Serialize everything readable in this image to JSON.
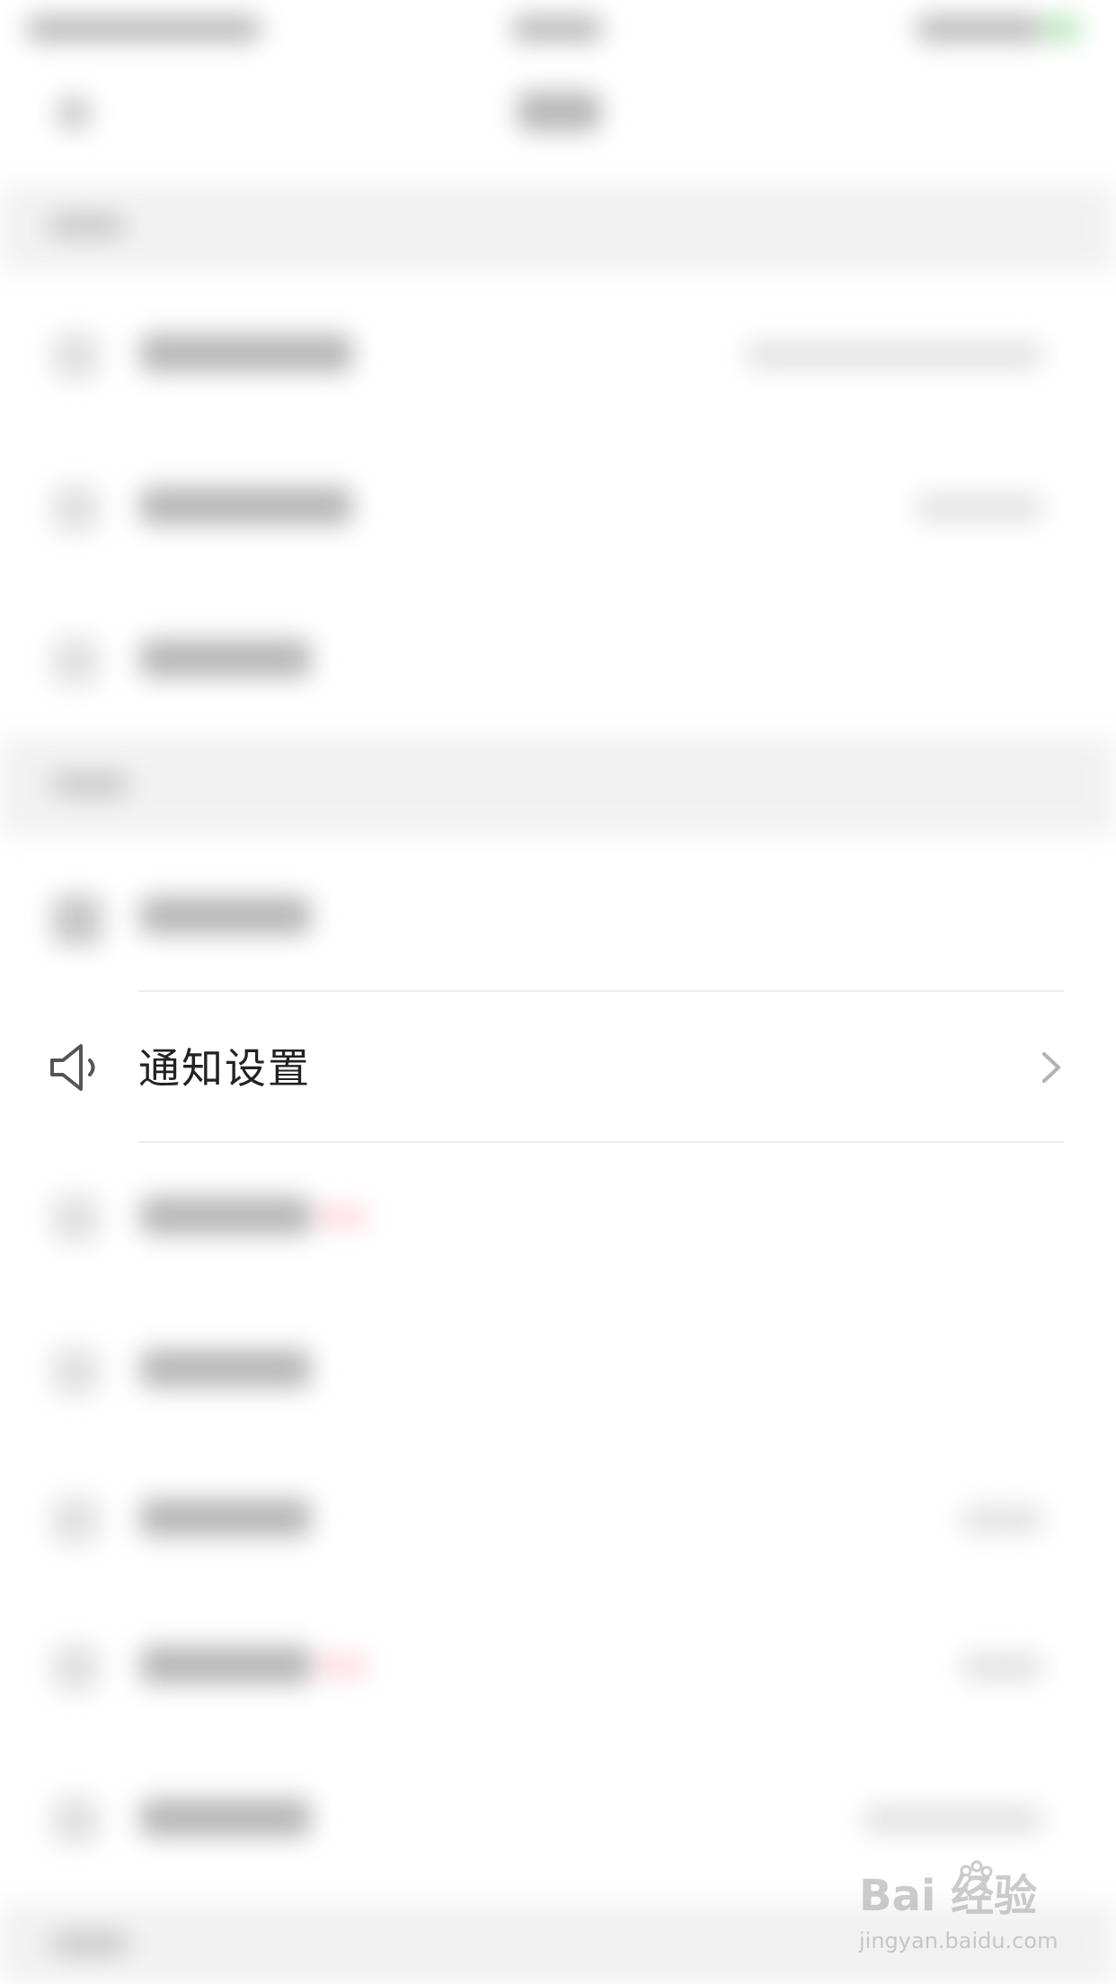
{
  "focused_item": {
    "label": "通知设置",
    "icon": "speaker-icon",
    "accent_color": "#222222"
  },
  "watermark": {
    "logo": "Bai  经验",
    "url": "jingyan.baidu.com"
  }
}
